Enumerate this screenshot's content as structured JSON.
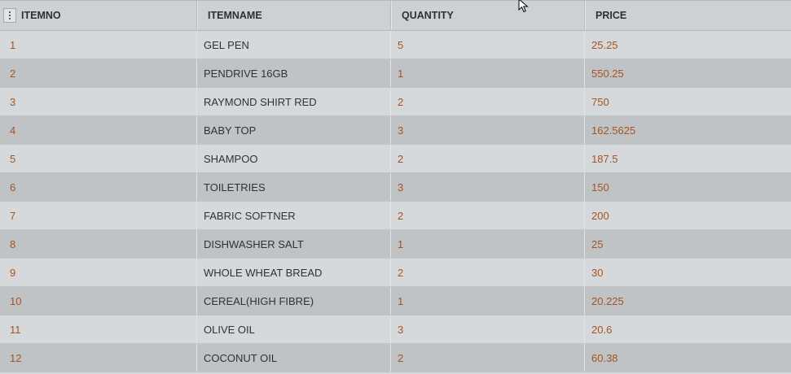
{
  "columns": [
    {
      "label": "ITEMNO"
    },
    {
      "label": "ITEMNAME"
    },
    {
      "label": "QUANTITY"
    },
    {
      "label": "PRICE"
    }
  ],
  "rows": [
    {
      "itemno": "1",
      "itemname": "GEL PEN",
      "quantity": "5",
      "price": "25.25"
    },
    {
      "itemno": "2",
      "itemname": "PENDRIVE 16GB",
      "quantity": "1",
      "price": "550.25"
    },
    {
      "itemno": "3",
      "itemname": "RAYMOND SHIRT RED",
      "quantity": "2",
      "price": "750"
    },
    {
      "itemno": "4",
      "itemname": "BABY TOP",
      "quantity": "3",
      "price": "162.5625"
    },
    {
      "itemno": "5",
      "itemname": "SHAMPOO",
      "quantity": "2",
      "price": "187.5"
    },
    {
      "itemno": "6",
      "itemname": "TOILETRIES",
      "quantity": "3",
      "price": "150"
    },
    {
      "itemno": "7",
      "itemname": "FABRIC SOFTNER",
      "quantity": "2",
      "price": "200"
    },
    {
      "itemno": "8",
      "itemname": "DISHWASHER SALT",
      "quantity": "1",
      "price": "25"
    },
    {
      "itemno": "9",
      "itemname": "WHOLE WHEAT BREAD",
      "quantity": "2",
      "price": "30"
    },
    {
      "itemno": "10",
      "itemname": "CEREAL(HIGH FIBRE)",
      "quantity": "1",
      "price": "20.225"
    },
    {
      "itemno": "11",
      "itemname": "OLIVE OIL",
      "quantity": "3",
      "price": "20.6"
    },
    {
      "itemno": "12",
      "itemname": "COCONUT OIL",
      "quantity": "2",
      "price": "60.38"
    }
  ],
  "icons": {
    "column_menu": "vertical-dots-icon",
    "cursor": "mouse-pointer-icon"
  },
  "colors": {
    "number_text": "#a4541f",
    "name_text": "#2f3335",
    "row_light": "#d6d9db",
    "row_dark": "#bfc3c6",
    "header_bg": "#ced1d4"
  }
}
